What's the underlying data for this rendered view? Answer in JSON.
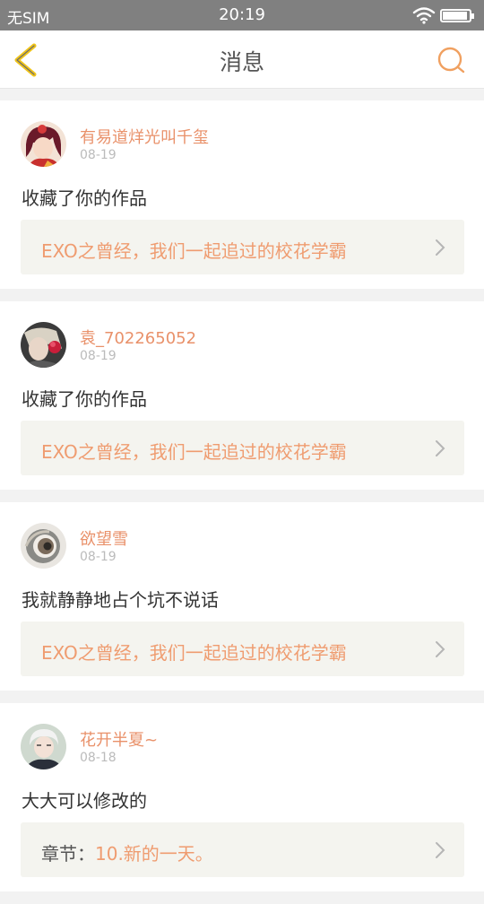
{
  "status_bar": {
    "carrier": "无SIM",
    "time": "20:19"
  },
  "nav": {
    "title": "消息",
    "back_icon": "chevron-left-icon",
    "search_icon": "search-icon"
  },
  "colors": {
    "accent": "#e9916a",
    "back_icon": "#f0c419",
    "work_bg": "#f4f4ef"
  },
  "messages": [
    {
      "user": "有易道烊光叫千玺",
      "date": "08-19",
      "text": "收藏了你的作品",
      "work": {
        "label": "",
        "title": "EXO之曾经，我们一起追过的校花学霸"
      }
    },
    {
      "user": "袁_702265052",
      "date": "08-19",
      "text": "收藏了你的作品",
      "work": {
        "label": "",
        "title": "EXO之曾经，我们一起追过的校花学霸"
      }
    },
    {
      "user": "欲望雪",
      "date": "08-19",
      "text": "我就静静地占个坑不说话",
      "work": {
        "label": "",
        "title": "EXO之曾经，我们一起追过的校花学霸"
      }
    },
    {
      "user": "花开半夏~",
      "date": "08-18",
      "text": "大大可以修改的",
      "work": {
        "label": "章节：",
        "title": "10.新的一天。"
      }
    }
  ]
}
